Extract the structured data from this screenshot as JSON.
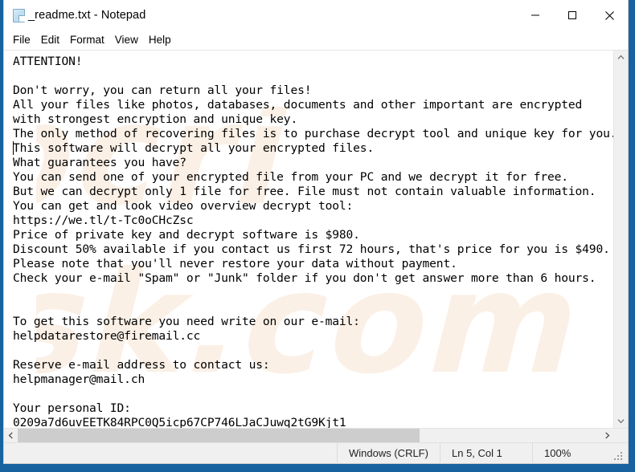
{
  "window": {
    "title": "_readme.txt - Notepad",
    "icon": "notepad-document-icon",
    "minimize_label": "—",
    "maximize_label": "□",
    "close_label": "✕"
  },
  "menu": {
    "items": [
      {
        "label": "File"
      },
      {
        "label": "Edit"
      },
      {
        "label": "Format"
      },
      {
        "label": "View"
      },
      {
        "label": "Help"
      }
    ]
  },
  "editor": {
    "text": "ATTENTION!\n\nDon't worry, you can return all your files!\nAll your files like photos, databases, documents and other important are encrypted\nwith strongest encryption and unique key.\nThe only method of recovering files is to purchase decrypt tool and unique key for you.\nThis software will decrypt all your encrypted files.\nWhat guarantees you have?\nYou can send one of your encrypted file from your PC and we decrypt it for free.\nBut we can decrypt only 1 file for free. File must not contain valuable information.\nYou can get and look video overview decrypt tool:\nhttps://we.tl/t-Tc0oCHcZsc\nPrice of private key and decrypt software is $980.\nDiscount 50% available if you contact us first 72 hours, that's price for you is $490.\nPlease note that you'll never restore your data without payment.\nCheck your e-mail \"Spam\" or \"Junk\" folder if you don't get answer more than 6 hours.\n\n\nTo get this software you need write on our e-mail:\nhelpdatarestore@firemail.cc\n\nReserve e-mail address to contact us:\nhelpmanager@mail.ch\n\nYour personal ID:\n0209a7d6uvEETK84RPC0Q5icp67CP746LJaCJuwq2tG9Kjt1",
    "watermark_text": "pcrisk.com"
  },
  "status_bar": {
    "line_ending": "Windows (CRLF)",
    "cursor_position": "Ln 5, Col 1",
    "zoom": "100%"
  },
  "colors": {
    "desktop": "#18639f",
    "window_bg": "#ffffff",
    "status_bg": "#f0f0f0",
    "scroll_thumb": "#cdcdcd",
    "text": "#000000",
    "watermark": "#fbf0e6"
  }
}
